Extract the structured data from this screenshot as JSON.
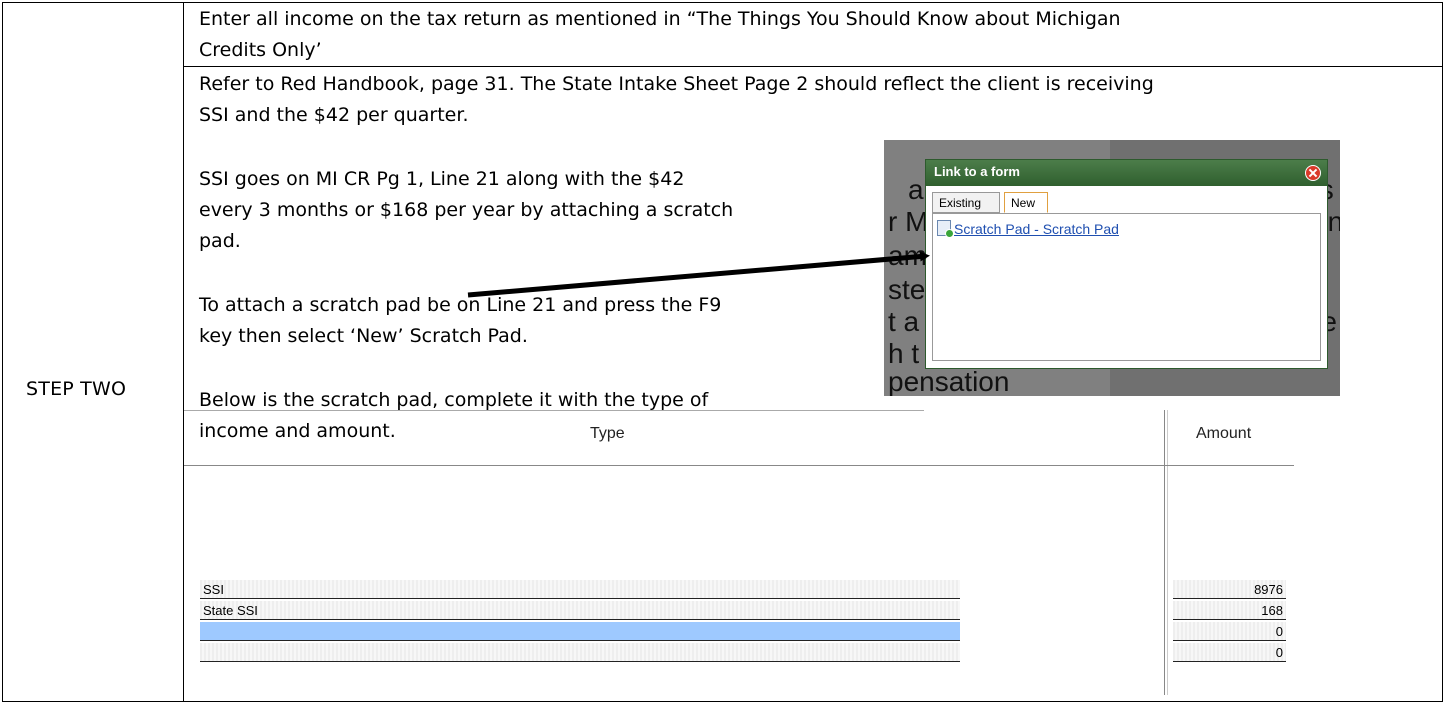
{
  "step_label": "STEP TWO",
  "row1": {
    "line1": "Enter all income on the tax return as mentioned in “The Things You Should Know about Michigan",
    "line2": "Credits Only’"
  },
  "row2": {
    "line1": "Refer to Red Handbook, page 31.  The State Intake Sheet Page 2 should reflect the client is receiving",
    "line2": "SSI and the $42 per quarter.",
    "para2_line1": "SSI goes on MI CR Pg 1, Line 21 along with the $42",
    "para2_line2": "every 3 months or $168 per year by attaching a scratch",
    "para2_line3": "pad.",
    "para3_line1": "To attach a scratch pad be on Line 21 and press the F9",
    "para3_line2": "key then select ‘New’ Scratch Pad.",
    "para4_line1": "Below is the scratch pad, complete it with the type of",
    "para4_line2": "income and amount."
  },
  "screenshot": {
    "bg_fragments": [
      "a",
      "ts",
      "r M",
      "en",
      "am",
      "n",
      "ste",
      "t a",
      "re",
      "h t",
      "pensation"
    ],
    "dialog": {
      "title": "Link to a form",
      "tabs": [
        "Existing",
        "New"
      ],
      "active_tab": "New",
      "link_text": "Scratch Pad - Scratch Pad"
    }
  },
  "scratch_pad": {
    "headers": {
      "type": "Type",
      "amount": "Amount"
    },
    "rows": [
      {
        "type": "SSI",
        "amount": "8976"
      },
      {
        "type": "State SSI",
        "amount": "168"
      },
      {
        "type": "",
        "amount": "0"
      },
      {
        "type": "",
        "amount": "0"
      }
    ]
  }
}
